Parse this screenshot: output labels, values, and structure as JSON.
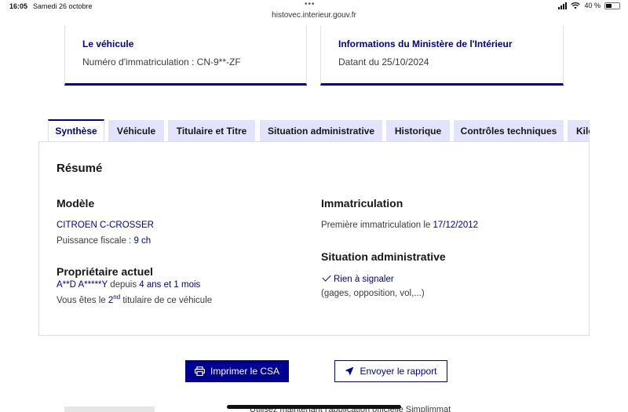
{
  "status_bar": {
    "time": "16:05",
    "date": "Samedi 26 octobre",
    "battery": "40 %"
  },
  "browser": {
    "url": "histovec.interieur.gouv.fr"
  },
  "cards": {
    "vehicle": {
      "title": "Le véhicule",
      "text": "Numéro d'immatriculation : CN-9**-ZF"
    },
    "ministry": {
      "title": "Informations du Ministère de l'Intérieur",
      "text": "Datant du 25/10/2024"
    }
  },
  "tabs": [
    {
      "label": "Synthèse",
      "active": true
    },
    {
      "label": "Véhicule"
    },
    {
      "label": "Titulaire et Titre"
    },
    {
      "label": "Situation administrative"
    },
    {
      "label": "Historique"
    },
    {
      "label": "Contrôles techniques"
    },
    {
      "label": "Kilo"
    }
  ],
  "summary": {
    "heading": "Résumé",
    "model": {
      "heading": "Modèle",
      "name": "CITROEN C-CROSSER",
      "fiscal_label": "Puissance fiscale : ",
      "fiscal_value": "9 ch"
    },
    "owner": {
      "heading": "Propriétaire actuel",
      "name": "A**D A*****Y",
      "since_label": " depuis ",
      "since_value": "4 ans et 1 mois",
      "rank_prefix": "Vous êtes le ",
      "rank_num": "2",
      "rank_sup": "nd",
      "rank_suffix": " titulaire de ce véhicule"
    },
    "registration": {
      "heading": "Immatriculation",
      "label": "Première immatriculation le ",
      "date": "17/12/2012"
    },
    "admin": {
      "heading": "Situation administrative",
      "status": "Rien à signaler",
      "note": "(gages, opposition, vol,...)"
    }
  },
  "actions": {
    "print_label": "Imprimer le CSA",
    "send_label": "Envoyer le rapport"
  },
  "footer": {
    "text": "Utilisez maintenant l'application officielle Simplimmat"
  },
  "colors": {
    "primary": "#000091",
    "tab_bg": "#e3e3fd"
  }
}
